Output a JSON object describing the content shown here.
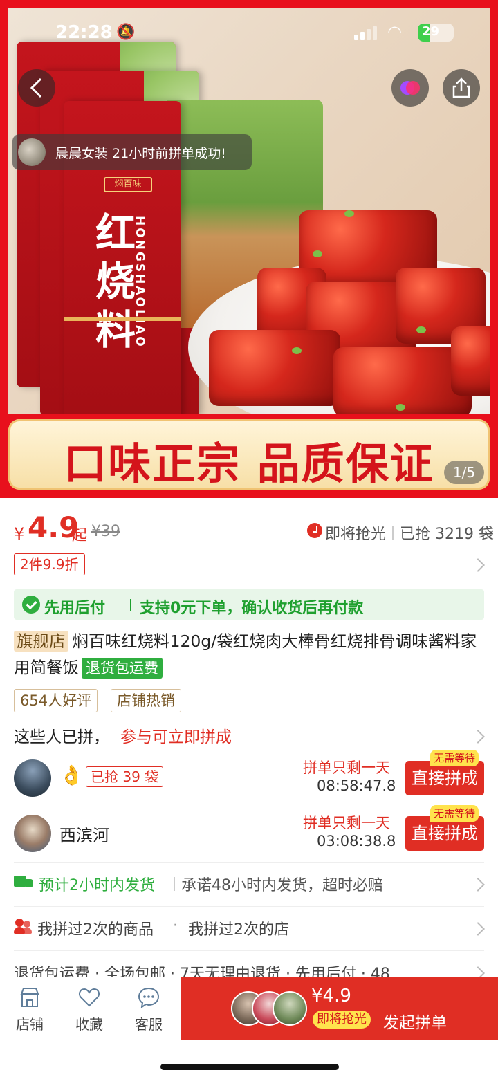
{
  "status_bar": {
    "time": "22:28",
    "battery": "29"
  },
  "hero": {
    "toast_text": "晨晨女装 21小时前拼单成功!",
    "banner_text": "口味正宗  品质保证",
    "pager": "1/5",
    "package_title": "红烧料",
    "package_brand": "焖百味",
    "package_pinyin": "HONGSHAOLIAO"
  },
  "price": {
    "currency": "¥",
    "value": "4.9",
    "from": "起",
    "original": "¥39",
    "soon_label": "即将抢光",
    "sold": "已抢 3219 袋"
  },
  "discount_tag": "2件9.9折",
  "pay_later": {
    "title": "先用后付",
    "desc": "支持0元下单，确认收货后再付款"
  },
  "product": {
    "store_tag": "旗舰店",
    "name": "焖百味红烧料120g/袋红烧肉大棒骨红烧排骨调味酱料家用简餐饭",
    "return_tag": "退货包运费"
  },
  "tags": [
    "654人好评",
    "店铺热销"
  ],
  "join": {
    "title": "这些人已拼，",
    "title_red": "参与可立即拼成",
    "groups": [
      {
        "name": "",
        "emoji": "👌",
        "grab_tag": "已抢 39 袋",
        "left_label": "拼单只剩一天",
        "countdown": "08:58:47.8",
        "button": "直接拼成",
        "nowait": "无需等待"
      },
      {
        "name": "西滨河",
        "emoji": "",
        "grab_tag": "",
        "left_label": "拼单只剩一天",
        "countdown": "03:08:38.8",
        "button": "直接拼成",
        "nowait": "无需等待"
      }
    ]
  },
  "shipping": {
    "green": "预计2小时内发货",
    "gray": "承诺48小时内发货，超时必赔"
  },
  "history": {
    "item1": "我拼过2次的商品",
    "dot": "·",
    "item2": "我拼过2次的店"
  },
  "services": "退货包运费 · 全场包邮 · 7天无理由退货 · 先用后付 · 48...",
  "bottom": {
    "tabs": [
      {
        "label": "店铺",
        "icon": "store-icon"
      },
      {
        "label": "收藏",
        "icon": "heart-icon"
      },
      {
        "label": "客服",
        "icon": "chat-icon"
      }
    ],
    "buy_price": "¥4.9",
    "buy_soon": "即将抢光",
    "buy_label": "发起拼单"
  },
  "colors": {
    "brand_red": "#e02e24",
    "green": "#2fae3f",
    "gold": "#f7dfa6"
  }
}
